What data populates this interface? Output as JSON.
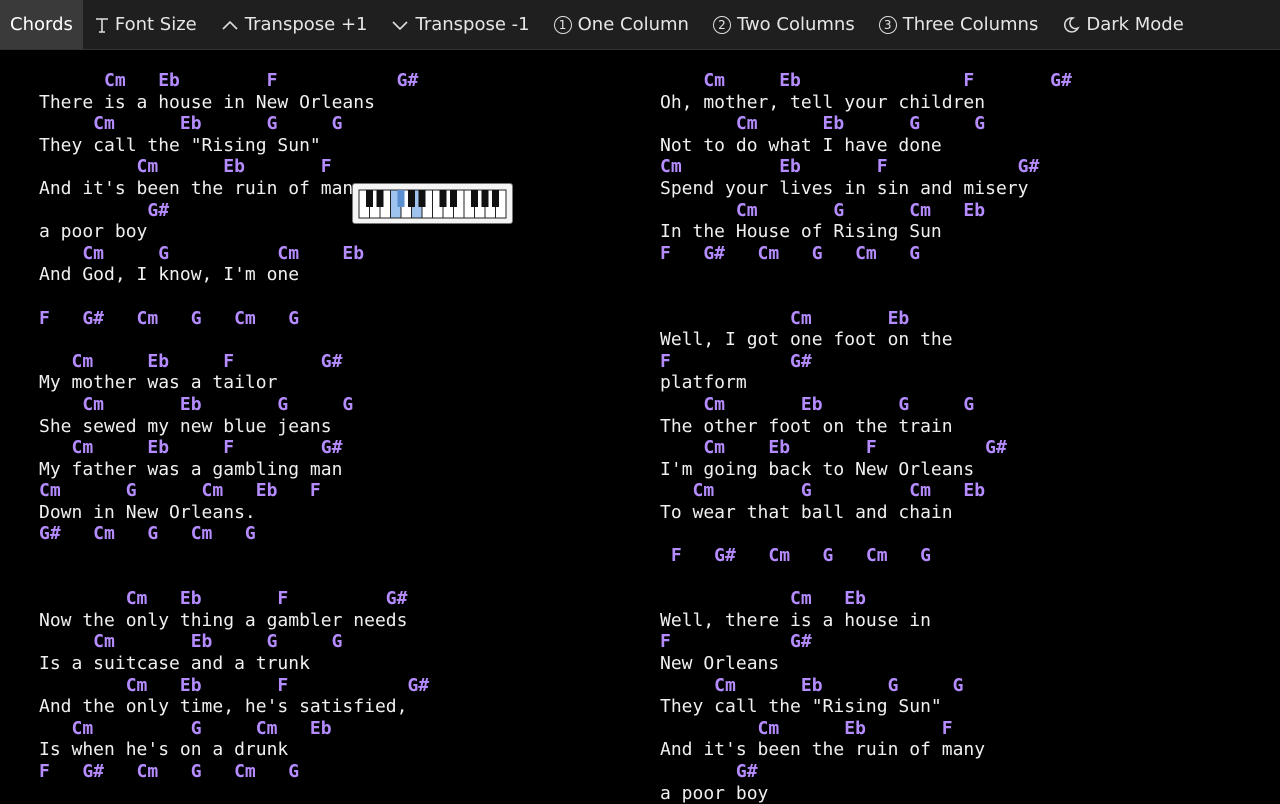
{
  "toolbar": {
    "items": [
      {
        "label": "Chords",
        "icon": ""
      },
      {
        "label": "Font Size",
        "icon": "font-size-icon"
      },
      {
        "label": "Transpose +1",
        "icon": "chevron-up-icon"
      },
      {
        "label": "Transpose -1",
        "icon": "chevron-down-icon"
      },
      {
        "label": "One Column",
        "icon": "circled-one-icon",
        "glyph": "1"
      },
      {
        "label": "Two Columns",
        "icon": "circled-two-icon",
        "glyph": "2"
      },
      {
        "label": "Three Columns",
        "icon": "circled-three-icon",
        "glyph": "3"
      },
      {
        "label": "Dark Mode",
        "icon": "moon-icon"
      }
    ],
    "active": "Chords"
  },
  "colors": {
    "chord": "#b58cff",
    "lyric": "#f0f0f0",
    "background": "#000000",
    "toolbar": "#1f1f1f"
  },
  "piano_widget": {
    "icon": "piano-keyboard-icon"
  },
  "song": {
    "left_column": [
      {
        "type": "chord",
        "text": "      Cm   Eb        F           G#"
      },
      {
        "type": "lyric",
        "text": "There is a house in New Orleans"
      },
      {
        "type": "chord",
        "text": "     Cm      Eb      G     G"
      },
      {
        "type": "lyric",
        "text": "They call the \"Rising Sun\""
      },
      {
        "type": "chord",
        "text": "         Cm      Eb       F"
      },
      {
        "type": "lyric",
        "text": "And it's been the ruin of many"
      },
      {
        "type": "chord",
        "text": "          G#"
      },
      {
        "type": "lyric",
        "text": "a poor boy"
      },
      {
        "type": "chord",
        "text": "    Cm     G          Cm    Eb"
      },
      {
        "type": "lyric",
        "text": "And God, I know, I'm one"
      },
      {
        "type": "blank",
        "text": ""
      },
      {
        "type": "chord",
        "text": "F   G#   Cm   G   Cm   G"
      },
      {
        "type": "blank",
        "text": ""
      },
      {
        "type": "chord",
        "text": "   Cm     Eb     F        G#"
      },
      {
        "type": "lyric",
        "text": "My mother was a tailor"
      },
      {
        "type": "chord",
        "text": "    Cm       Eb       G     G"
      },
      {
        "type": "lyric",
        "text": "She sewed my new blue jeans"
      },
      {
        "type": "chord",
        "text": "   Cm     Eb     F        G#"
      },
      {
        "type": "lyric",
        "text": "My father was a gambling man"
      },
      {
        "type": "chord",
        "text": "Cm      G      Cm   Eb   F"
      },
      {
        "type": "lyric",
        "text": "Down in New Orleans."
      },
      {
        "type": "chord",
        "text": "G#   Cm   G   Cm   G"
      },
      {
        "type": "blank",
        "text": ""
      },
      {
        "type": "blank",
        "text": ""
      },
      {
        "type": "chord",
        "text": "        Cm   Eb       F         G#"
      },
      {
        "type": "lyric",
        "text": "Now the only thing a gambler needs"
      },
      {
        "type": "chord",
        "text": "     Cm       Eb     G     G"
      },
      {
        "type": "lyric",
        "text": "Is a suitcase and a trunk"
      },
      {
        "type": "chord",
        "text": "        Cm   Eb       F           G#"
      },
      {
        "type": "lyric",
        "text": "And the only time, he's satisfied,"
      },
      {
        "type": "chord",
        "text": "   Cm         G     Cm   Eb"
      },
      {
        "type": "lyric",
        "text": "Is when he's on a drunk"
      },
      {
        "type": "chord",
        "text": "F   G#   Cm   G   Cm   G"
      }
    ],
    "right_column": [
      {
        "type": "chord",
        "text": "    Cm     Eb               F       G#"
      },
      {
        "type": "lyric",
        "text": "Oh, mother, tell your children"
      },
      {
        "type": "chord",
        "text": "       Cm      Eb      G     G"
      },
      {
        "type": "lyric",
        "text": "Not to do what I have done"
      },
      {
        "type": "chord",
        "text": "Cm         Eb       F            G#"
      },
      {
        "type": "lyric",
        "text": "Spend your lives in sin and misery"
      },
      {
        "type": "chord",
        "text": "       Cm       G      Cm   Eb"
      },
      {
        "type": "lyric",
        "text": "In the House of Rising Sun"
      },
      {
        "type": "chord",
        "text": "F   G#   Cm   G   Cm   G"
      },
      {
        "type": "blank",
        "text": ""
      },
      {
        "type": "blank",
        "text": ""
      },
      {
        "type": "chord",
        "text": "            Cm       Eb"
      },
      {
        "type": "lyric",
        "text": "Well, I got one foot on the"
      },
      {
        "type": "chord",
        "text": "F           G#"
      },
      {
        "type": "lyric",
        "text": "platform"
      },
      {
        "type": "chord",
        "text": "    Cm       Eb       G     G"
      },
      {
        "type": "lyric",
        "text": "The other foot on the train"
      },
      {
        "type": "chord",
        "text": "    Cm    Eb       F          G#"
      },
      {
        "type": "lyric",
        "text": "I'm going back to New Orleans"
      },
      {
        "type": "chord",
        "text": "   Cm        G         Cm   Eb"
      },
      {
        "type": "lyric",
        "text": "To wear that ball and chain"
      },
      {
        "type": "blank",
        "text": ""
      },
      {
        "type": "chord",
        "text": " F   G#   Cm   G   Cm   G"
      },
      {
        "type": "blank",
        "text": ""
      },
      {
        "type": "chord",
        "text": "            Cm   Eb"
      },
      {
        "type": "lyric",
        "text": "Well, there is a house in"
      },
      {
        "type": "chord",
        "text": "F           G#"
      },
      {
        "type": "lyric",
        "text": "New Orleans"
      },
      {
        "type": "chord",
        "text": "     Cm      Eb      G     G"
      },
      {
        "type": "lyric",
        "text": "They call the \"Rising Sun\""
      },
      {
        "type": "chord",
        "text": "         Cm      Eb       F"
      },
      {
        "type": "lyric",
        "text": "And it's been the ruin of many"
      },
      {
        "type": "chord",
        "text": "       G#"
      },
      {
        "type": "lyric",
        "text": "a poor boy"
      }
    ]
  }
}
